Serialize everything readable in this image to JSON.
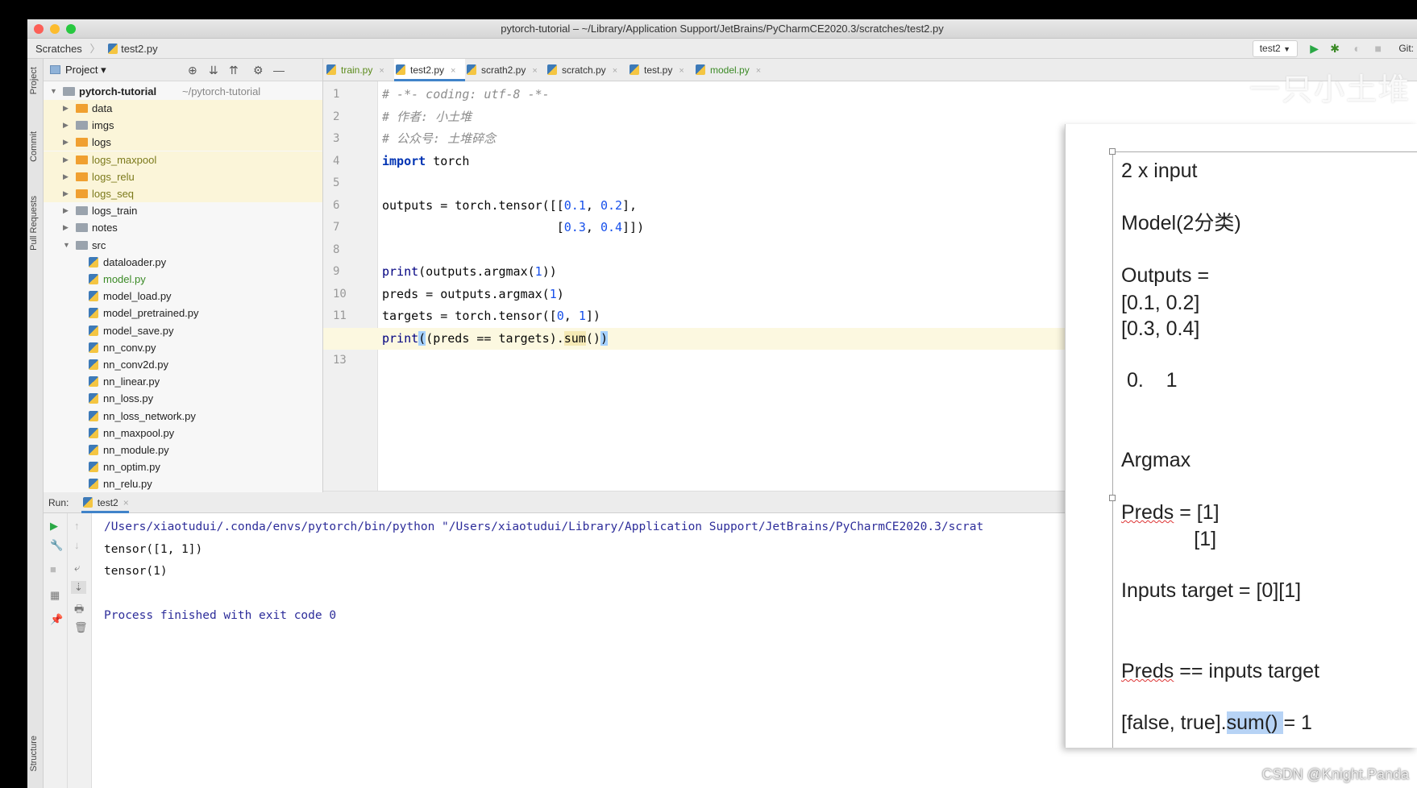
{
  "window": {
    "title": "pytorch-tutorial – ~/Library/Application Support/JetBrains/PyCharmCE2020.3/scratches/test2.py"
  },
  "navbar": {
    "breadcrumb": [
      "Scratches",
      "test2.py"
    ],
    "run_config": "test2",
    "git_label": "Git:"
  },
  "side_strip": {
    "items": [
      "Project",
      "Commit",
      "Pull Requests",
      "Structure"
    ]
  },
  "project": {
    "header": "Project ▾",
    "root": {
      "name": "pytorch-tutorial",
      "path": "~/pytorch-tutorial"
    },
    "items": [
      {
        "name": "data",
        "type": "folder",
        "color": "orange",
        "hl": true
      },
      {
        "name": "imgs",
        "type": "folder",
        "color": "gray",
        "hl": true
      },
      {
        "name": "logs",
        "type": "folder",
        "color": "orange",
        "hl": true
      },
      {
        "name": "logs_maxpool",
        "type": "folder",
        "color": "orange",
        "hl": true,
        "text": "#7c7a1c"
      },
      {
        "name": "logs_relu",
        "type": "folder",
        "color": "orange",
        "hl": true,
        "text": "#7c7a1c"
      },
      {
        "name": "logs_seq",
        "type": "folder",
        "color": "orange",
        "hl": true,
        "text": "#7c7a1c"
      },
      {
        "name": "logs_train",
        "type": "folder",
        "color": "gray"
      },
      {
        "name": "notes",
        "type": "folder",
        "color": "gray"
      },
      {
        "name": "src",
        "type": "folder",
        "color": "gray",
        "open": true
      },
      {
        "name": "dataloader.py",
        "type": "file"
      },
      {
        "name": "model.py",
        "type": "file",
        "text": "#3b8a26"
      },
      {
        "name": "model_load.py",
        "type": "file"
      },
      {
        "name": "model_pretrained.py",
        "type": "file"
      },
      {
        "name": "model_save.py",
        "type": "file"
      },
      {
        "name": "nn_conv.py",
        "type": "file"
      },
      {
        "name": "nn_conv2d.py",
        "type": "file"
      },
      {
        "name": "nn_linear.py",
        "type": "file"
      },
      {
        "name": "nn_loss.py",
        "type": "file"
      },
      {
        "name": "nn_loss_network.py",
        "type": "file"
      },
      {
        "name": "nn_maxpool.py",
        "type": "file"
      },
      {
        "name": "nn_module.py",
        "type": "file"
      },
      {
        "name": "nn_optim.py",
        "type": "file"
      },
      {
        "name": "nn_relu.py",
        "type": "file"
      }
    ]
  },
  "tabs": [
    {
      "label": "train.py",
      "color": "#5a8a1a"
    },
    {
      "label": "test2.py",
      "active": true
    },
    {
      "label": "scrath2.py"
    },
    {
      "label": "scratch.py"
    },
    {
      "label": "test.py"
    },
    {
      "label": "model.py",
      "color": "#3b8a26"
    }
  ],
  "editor": {
    "current_line": 12,
    "lines": [
      [
        [
          "# -*- coding: utf-8 -*-",
          "com"
        ]
      ],
      [
        [
          "# 作者: 小土堆",
          "com"
        ]
      ],
      [
        [
          "# 公众号: 土堆碎念",
          "com"
        ]
      ],
      [
        [
          "import",
          "kw"
        ],
        [
          " torch",
          ""
        ]
      ],
      [],
      [
        [
          "outputs = torch.tensor([[",
          ""
        ],
        [
          "0.1",
          "num"
        ],
        [
          ", ",
          ""
        ],
        [
          "0.2",
          "num"
        ],
        [
          "],",
          ""
        ]
      ],
      [
        [
          "                        [",
          ""
        ],
        [
          "0.3",
          "num"
        ],
        [
          ", ",
          ""
        ],
        [
          "0.4",
          "num"
        ],
        [
          "]])",
          ""
        ]
      ],
      [],
      [
        [
          "print",
          "bi"
        ],
        [
          "(outputs.argmax(",
          ""
        ],
        [
          "1",
          "num"
        ],
        [
          "))",
          ""
        ]
      ],
      [
        [
          "preds = outputs.argmax(",
          ""
        ],
        [
          "1",
          "num"
        ],
        [
          ")",
          ""
        ]
      ],
      [
        [
          "targets = torch.tensor([",
          ""
        ],
        [
          "0",
          "num"
        ],
        [
          ", ",
          ""
        ],
        [
          "1",
          "num"
        ],
        [
          "])",
          ""
        ]
      ],
      [
        [
          "print",
          "bi"
        ],
        [
          "(",
          "br"
        ],
        [
          "(preds == targets).",
          ""
        ],
        [
          "sum",
          "hl"
        ],
        [
          "()",
          ""
        ],
        [
          ")",
          "br"
        ]
      ],
      []
    ]
  },
  "run": {
    "label": "Run:",
    "tab": "test2",
    "output": [
      {
        "text": "/Users/xiaotudui/.conda/envs/pytorch/bin/python \"/Users/xiaotudui/Library/Application Support/JetBrains/PyCharmCE2020.3/scrat",
        "blue": true
      },
      {
        "text": "tensor([1, 1])"
      },
      {
        "text": "tensor(1)"
      },
      {
        "text": ""
      },
      {
        "text": "Process finished with exit code 0",
        "blue": true
      }
    ]
  },
  "slide": {
    "lines": [
      "2 x input",
      "Model(2分类)",
      "Outputs =",
      "[0.1, 0.2]",
      "[0.3, 0.4]",
      " 0.    1",
      "Argmax",
      "Preds = [1]",
      "             [1]",
      "Inputs target = [0][1]",
      "Preds == inputs target",
      "[false, true].sum() = 1"
    ]
  },
  "watermarks": {
    "csdn": "CSDN @Knight.Panda",
    "channel": "一只小土堆"
  }
}
